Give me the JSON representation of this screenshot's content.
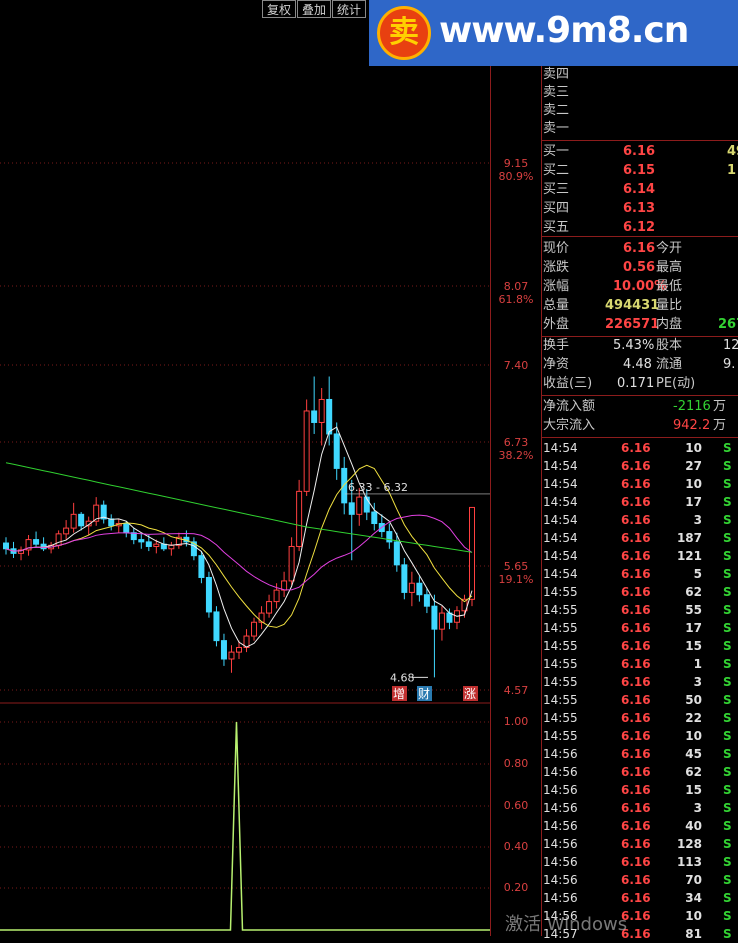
{
  "toolbar": {
    "fuquan": "复权",
    "diejia": "叠加",
    "tongji": "统计"
  },
  "watermark": {
    "text": "www.9m8.cn",
    "logo_char": "卖"
  },
  "price_axis": {
    "labels": [
      {
        "v": "9.15",
        "p": "80.9%"
      },
      {
        "v": "8.07",
        "p": "61.8%"
      },
      {
        "v": "7.40",
        "p": ""
      },
      {
        "v": "6.73",
        "p": "38.2%"
      },
      {
        "v": "5.65",
        "p": "19.1%"
      },
      {
        "v": "4.57",
        "p": ""
      }
    ]
  },
  "indicator_axis": [
    "1.00",
    "0.80",
    "0.60",
    "0.40",
    "0.20"
  ],
  "annotations": {
    "high": "6.33 - 6.32",
    "low": "4.68",
    "badges": [
      "增",
      "财",
      "涨"
    ]
  },
  "sell_levels": [
    "卖四",
    "卖三",
    "卖二",
    "卖一"
  ],
  "buy_levels": [
    {
      "label": "买一",
      "price": "6.16",
      "vol": "49"
    },
    {
      "label": "买二",
      "price": "6.15",
      "vol": "1"
    },
    {
      "label": "买三",
      "price": "6.14",
      "vol": ""
    },
    {
      "label": "买四",
      "price": "6.13",
      "vol": ""
    },
    {
      "label": "买五",
      "price": "6.12",
      "vol": ""
    }
  ],
  "quote": {
    "xianjia": "现价",
    "xianjia_v": "6.16",
    "jinkai": "今开",
    "zhangdie": "涨跌",
    "zhangdie_v": "0.56",
    "zuigao": "最高",
    "zhangfu": "涨幅",
    "zhangfu_v": "10.00%",
    "zuidi": "最低",
    "zongliang": "总量",
    "zongliang_v": "494431",
    "liangbi": "量比",
    "waipan": "外盘",
    "waipan_v": "226571",
    "neipan": "内盘",
    "neipan_v": "267"
  },
  "fund": {
    "huanshou": "换手",
    "huanshou_v": "5.43%",
    "guben": "股本",
    "guben_v": "12",
    "jingzi": "净资",
    "jingzi_v": "4.48",
    "liutong": "流通",
    "liutong_v": "9.",
    "shouyi": "收益(三)",
    "shouyi_v": "0.171",
    "pe": "PE(动)"
  },
  "flow": {
    "net_label": "净流入额",
    "net_v": "-2116",
    "net_unit": "万",
    "bulk_label": "大宗流入",
    "bulk_v": "942.2",
    "bulk_unit": "万"
  },
  "ticks": [
    {
      "t": "14:54",
      "p": "6.16",
      "v": "10",
      "s": "S"
    },
    {
      "t": "14:54",
      "p": "6.16",
      "v": "27",
      "s": "S"
    },
    {
      "t": "14:54",
      "p": "6.16",
      "v": "10",
      "s": "S"
    },
    {
      "t": "14:54",
      "p": "6.16",
      "v": "17",
      "s": "S"
    },
    {
      "t": "14:54",
      "p": "6.16",
      "v": "3",
      "s": "S"
    },
    {
      "t": "14:54",
      "p": "6.16",
      "v": "187",
      "s": "S"
    },
    {
      "t": "14:54",
      "p": "6.16",
      "v": "121",
      "s": "S"
    },
    {
      "t": "14:54",
      "p": "6.16",
      "v": "5",
      "s": "S"
    },
    {
      "t": "14:55",
      "p": "6.16",
      "v": "62",
      "s": "S"
    },
    {
      "t": "14:55",
      "p": "6.16",
      "v": "55",
      "s": "S"
    },
    {
      "t": "14:55",
      "p": "6.16",
      "v": "17",
      "s": "S"
    },
    {
      "t": "14:55",
      "p": "6.16",
      "v": "15",
      "s": "S"
    },
    {
      "t": "14:55",
      "p": "6.16",
      "v": "1",
      "s": "S"
    },
    {
      "t": "14:55",
      "p": "6.16",
      "v": "3",
      "s": "S"
    },
    {
      "t": "14:55",
      "p": "6.16",
      "v": "50",
      "s": "S"
    },
    {
      "t": "14:55",
      "p": "6.16",
      "v": "22",
      "s": "S"
    },
    {
      "t": "14:55",
      "p": "6.16",
      "v": "10",
      "s": "S"
    },
    {
      "t": "14:56",
      "p": "6.16",
      "v": "45",
      "s": "S"
    },
    {
      "t": "14:56",
      "p": "6.16",
      "v": "62",
      "s": "S"
    },
    {
      "t": "14:56",
      "p": "6.16",
      "v": "15",
      "s": "S"
    },
    {
      "t": "14:56",
      "p": "6.16",
      "v": "3",
      "s": "S"
    },
    {
      "t": "14:56",
      "p": "6.16",
      "v": "40",
      "s": "S"
    },
    {
      "t": "14:56",
      "p": "6.16",
      "v": "128",
      "s": "S"
    },
    {
      "t": "14:56",
      "p": "6.16",
      "v": "113",
      "s": "S"
    },
    {
      "t": "14:56",
      "p": "6.16",
      "v": "70",
      "s": "S"
    },
    {
      "t": "14:56",
      "p": "6.16",
      "v": "34",
      "s": "S"
    },
    {
      "t": "14:56",
      "p": "6.16",
      "v": "10",
      "s": "S"
    },
    {
      "t": "14:57",
      "p": "6.16",
      "v": "81",
      "s": "S"
    }
  ],
  "os_watermark": "激活 Windows",
  "chart_data": {
    "type": "candlestick",
    "ylim": [
      4.57,
      9.15
    ],
    "y_ticks": [
      9.15,
      8.07,
      7.4,
      6.73,
      5.65,
      4.57
    ],
    "fib_levels": {
      "80.9%": 9.15,
      "61.8%": 8.07,
      "38.2%": 6.73,
      "19.1%": 5.65
    },
    "marked_high": [
      6.33,
      6.32
    ],
    "marked_low": 4.68,
    "candles": [
      [
        5.85,
        5.9,
        5.75,
        5.8
      ],
      [
        5.8,
        5.86,
        5.72,
        5.76
      ],
      [
        5.76,
        5.82,
        5.7,
        5.79
      ],
      [
        5.79,
        5.92,
        5.74,
        5.88
      ],
      [
        5.88,
        5.95,
        5.82,
        5.84
      ],
      [
        5.84,
        5.9,
        5.78,
        5.8
      ],
      [
        5.8,
        5.86,
        5.76,
        5.83
      ],
      [
        5.83,
        5.96,
        5.8,
        5.93
      ],
      [
        5.93,
        6.05,
        5.88,
        5.98
      ],
      [
        5.98,
        6.2,
        5.94,
        6.1
      ],
      [
        6.1,
        6.12,
        5.96,
        6.0
      ],
      [
        6.0,
        6.08,
        5.92,
        6.04
      ],
      [
        6.04,
        6.25,
        6.0,
        6.18
      ],
      [
        6.18,
        6.22,
        6.02,
        6.06
      ],
      [
        6.06,
        6.1,
        5.96,
        6.0
      ],
      [
        6.0,
        6.06,
        5.94,
        6.02
      ],
      [
        6.02,
        6.04,
        5.9,
        5.94
      ],
      [
        5.94,
        5.98,
        5.84,
        5.88
      ],
      [
        5.88,
        5.94,
        5.8,
        5.86
      ],
      [
        5.86,
        5.92,
        5.78,
        5.82
      ],
      [
        5.82,
        5.88,
        5.76,
        5.84
      ],
      [
        5.84,
        5.9,
        5.78,
        5.8
      ],
      [
        5.8,
        5.86,
        5.74,
        5.83
      ],
      [
        5.83,
        5.94,
        5.8,
        5.9
      ],
      [
        5.9,
        5.96,
        5.82,
        5.86
      ],
      [
        5.86,
        5.9,
        5.7,
        5.74
      ],
      [
        5.74,
        5.78,
        5.5,
        5.55
      ],
      [
        5.55,
        5.6,
        5.2,
        5.25
      ],
      [
        5.25,
        5.3,
        4.95,
        5.0
      ],
      [
        5.0,
        5.06,
        4.78,
        4.84
      ],
      [
        4.84,
        4.96,
        4.72,
        4.9
      ],
      [
        4.9,
        5.0,
        4.84,
        4.94
      ],
      [
        4.94,
        5.1,
        4.9,
        5.04
      ],
      [
        5.04,
        5.2,
        5.0,
        5.16
      ],
      [
        5.16,
        5.3,
        5.1,
        5.24
      ],
      [
        5.24,
        5.4,
        5.2,
        5.34
      ],
      [
        5.34,
        5.5,
        5.28,
        5.44
      ],
      [
        5.44,
        5.6,
        5.38,
        5.52
      ],
      [
        5.52,
        5.9,
        5.48,
        5.82
      ],
      [
        5.82,
        6.4,
        5.78,
        6.3
      ],
      [
        6.3,
        7.1,
        6.26,
        7.0
      ],
      [
        7.0,
        7.3,
        6.8,
        6.9
      ],
      [
        6.9,
        7.2,
        6.7,
        7.1
      ],
      [
        7.1,
        7.3,
        6.7,
        6.8
      ],
      [
        6.8,
        6.9,
        6.4,
        6.5
      ],
      [
        6.5,
        6.6,
        6.1,
        6.2
      ],
      [
        6.2,
        6.4,
        5.7,
        6.1
      ],
      [
        6.1,
        6.33,
        6.0,
        6.25
      ],
      [
        6.25,
        6.32,
        6.05,
        6.12
      ],
      [
        6.12,
        6.2,
        5.96,
        6.02
      ],
      [
        6.02,
        6.1,
        5.9,
        5.95
      ],
      [
        5.95,
        6.02,
        5.8,
        5.86
      ],
      [
        5.86,
        5.94,
        5.6,
        5.66
      ],
      [
        5.66,
        5.72,
        5.36,
        5.42
      ],
      [
        5.42,
        5.6,
        5.3,
        5.5
      ],
      [
        5.5,
        5.56,
        5.34,
        5.4
      ],
      [
        5.4,
        5.46,
        5.24,
        5.3
      ],
      [
        5.3,
        5.4,
        4.68,
        5.1
      ],
      [
        5.1,
        5.3,
        5.0,
        5.24
      ],
      [
        5.24,
        5.28,
        5.1,
        5.16
      ],
      [
        5.16,
        5.3,
        5.1,
        5.26
      ],
      [
        5.26,
        5.4,
        5.2,
        5.36
      ],
      [
        5.36,
        6.16,
        5.3,
        6.16
      ]
    ],
    "indicator": {
      "ylim": [
        0,
        1.0
      ],
      "spike_index": 30,
      "spike_value": 1.0
    }
  }
}
